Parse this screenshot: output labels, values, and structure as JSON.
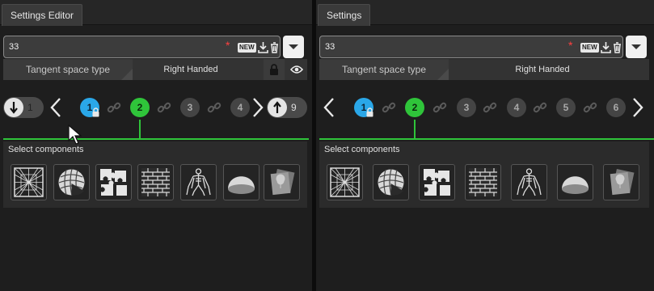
{
  "panels": [
    {
      "tab_title": "Settings Editor",
      "name_value": "33",
      "required_mark": "*",
      "new_badge": "NEW",
      "tangent_label": "Tangent space type",
      "tangent_value": "Right Handed",
      "nav": {
        "down_count": "1",
        "up_count": "9",
        "nodes": [
          "1",
          "2",
          "3",
          "4"
        ]
      },
      "section_title": "Select components"
    },
    {
      "tab_title": "Settings",
      "name_value": "33",
      "required_mark": "*",
      "new_badge": "NEW",
      "tangent_label": "Tangent space type",
      "tangent_value": "Right Handed",
      "nav": {
        "nodes": [
          "1",
          "2",
          "3",
          "4",
          "5",
          "6"
        ]
      },
      "section_title": "Select components"
    }
  ],
  "colors": {
    "active_node": "#2fc43a",
    "locked_node": "#2aa7e8",
    "required": "#ff4040"
  },
  "components": [
    "wireframe-icon",
    "sphere-icon",
    "puzzle-icon",
    "brick-wall-icon",
    "skeleton-icon",
    "dome-icon",
    "texture-icon"
  ]
}
